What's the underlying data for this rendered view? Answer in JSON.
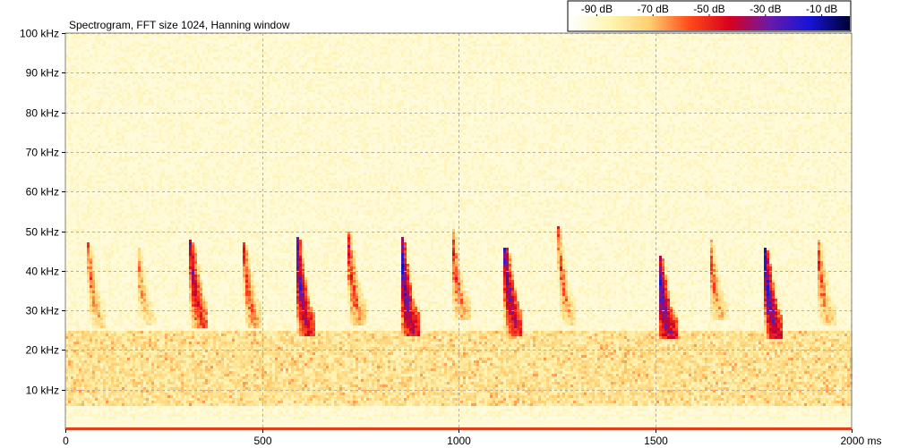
{
  "chart_data": {
    "type": "heatmap",
    "title": "Spectrogram, FFT size 1024, Hanning window",
    "xlabel": "",
    "ylabel": "",
    "x_unit": "ms",
    "y_unit": "kHz",
    "xlim": [
      0,
      2000
    ],
    "ylim": [
      0,
      100
    ],
    "x_ticks": [
      0,
      500,
      1000,
      1500,
      2000
    ],
    "x_tick_labels": [
      "0",
      "500",
      "1000",
      "1500",
      "2000 ms"
    ],
    "y_ticks": [
      10,
      20,
      30,
      40,
      50,
      60,
      70,
      80,
      90,
      100
    ],
    "y_tick_labels": [
      "10 kHz",
      "20 kHz",
      "30 kHz",
      "40 kHz",
      "50 kHz",
      "60 kHz",
      "70 kHz",
      "80 kHz",
      "90 kHz",
      "100 kHz"
    ],
    "grid": true,
    "color_scale": {
      "labels": [
        "-90 dB",
        "-70 dB",
        "-50 dB",
        "-30 dB",
        "-10 dB"
      ],
      "values_db": [
        -90,
        -70,
        -50,
        -30,
        -10
      ],
      "colors": [
        "#ffffff",
        "#fff6b4",
        "#ffd070",
        "#ff4a1a",
        "#d8001e",
        "#6a1aa8",
        "#1414d8",
        "#000030"
      ],
      "placement": "top-right"
    },
    "background_noise_db": -85,
    "noise_band_khz": [
      6,
      25
    ],
    "calls": [
      {
        "time_ms": 60,
        "f_start_khz": 46,
        "f_end_khz": 27,
        "peak_db": -52
      },
      {
        "time_ms": 185,
        "f_start_khz": 45,
        "f_end_khz": 28,
        "peak_db": -55
      },
      {
        "time_ms": 320,
        "f_start_khz": 47,
        "f_end_khz": 27,
        "peak_db": -38
      },
      {
        "time_ms": 455,
        "f_start_khz": 46,
        "f_end_khz": 27,
        "peak_db": -47
      },
      {
        "time_ms": 590,
        "f_start_khz": 48,
        "f_end_khz": 25,
        "peak_db": -30
      },
      {
        "time_ms": 720,
        "f_start_khz": 49,
        "f_end_khz": 28,
        "peak_db": -45
      },
      {
        "time_ms": 855,
        "f_start_khz": 48,
        "f_end_khz": 25,
        "peak_db": -28
      },
      {
        "time_ms": 985,
        "f_start_khz": 50,
        "f_end_khz": 29,
        "peak_db": -47
      },
      {
        "time_ms": 1120,
        "f_start_khz": 45,
        "f_end_khz": 25,
        "peak_db": -32
      },
      {
        "time_ms": 1255,
        "f_start_khz": 50,
        "f_end_khz": 28,
        "peak_db": -50
      },
      {
        "time_ms": 1510,
        "f_start_khz": 43,
        "f_end_khz": 24,
        "peak_db": -28
      },
      {
        "time_ms": 1640,
        "f_start_khz": 47,
        "f_end_khz": 29,
        "peak_db": -50
      },
      {
        "time_ms": 1780,
        "f_start_khz": 45,
        "f_end_khz": 24,
        "peak_db": -28
      },
      {
        "time_ms": 1915,
        "f_start_khz": 47,
        "f_end_khz": 28,
        "peak_db": -50
      }
    ]
  }
}
